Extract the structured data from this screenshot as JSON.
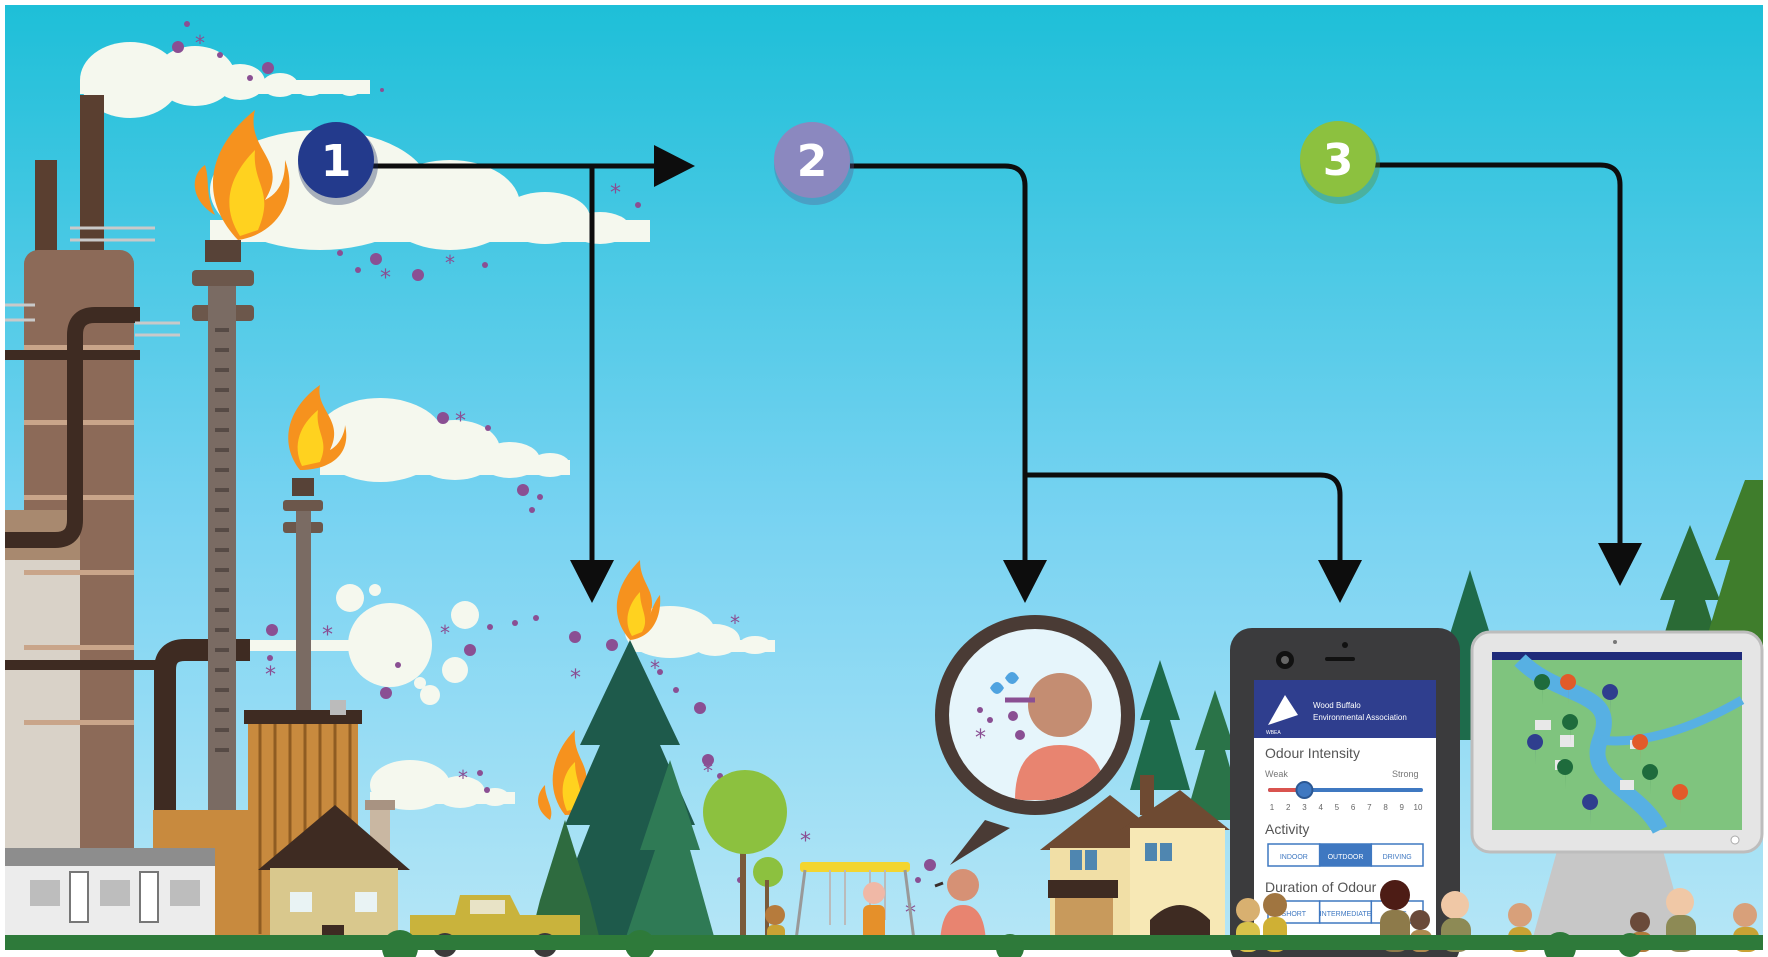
{
  "steps": [
    {
      "number": "1",
      "color": "#233a8c"
    },
    {
      "number": "2",
      "color": "#8b88bf"
    },
    {
      "number": "3",
      "color": "#8cc13f"
    }
  ],
  "phone_app": {
    "org_line1": "Wood Buffalo",
    "org_line2": "Environmental Association",
    "logo_text": "WBEA",
    "intensity_title": "Odour Intensity",
    "weak_label": "Weak",
    "strong_label": "Strong",
    "intensity_value": 3,
    "scale": [
      "1",
      "2",
      "3",
      "4",
      "5",
      "6",
      "7",
      "8",
      "9",
      "10"
    ],
    "activity_title": "Activity",
    "activity_options": [
      "INDOOR",
      "OUTDOOR",
      "DRIVING"
    ],
    "activity_selected": "OUTDOOR",
    "duration_title": "Duration of Odour",
    "duration_options": [
      "SHORT",
      "INTERMEDIATE",
      "LONG"
    ]
  },
  "colors": {
    "sky_top": "#1ebfd8",
    "sky_bottom": "#a9e2f5",
    "arrow": "#0d0d0d",
    "odour_particles": "#8a4f93",
    "flame_outer": "#f6921e",
    "flame_inner": "#ffd21f"
  }
}
